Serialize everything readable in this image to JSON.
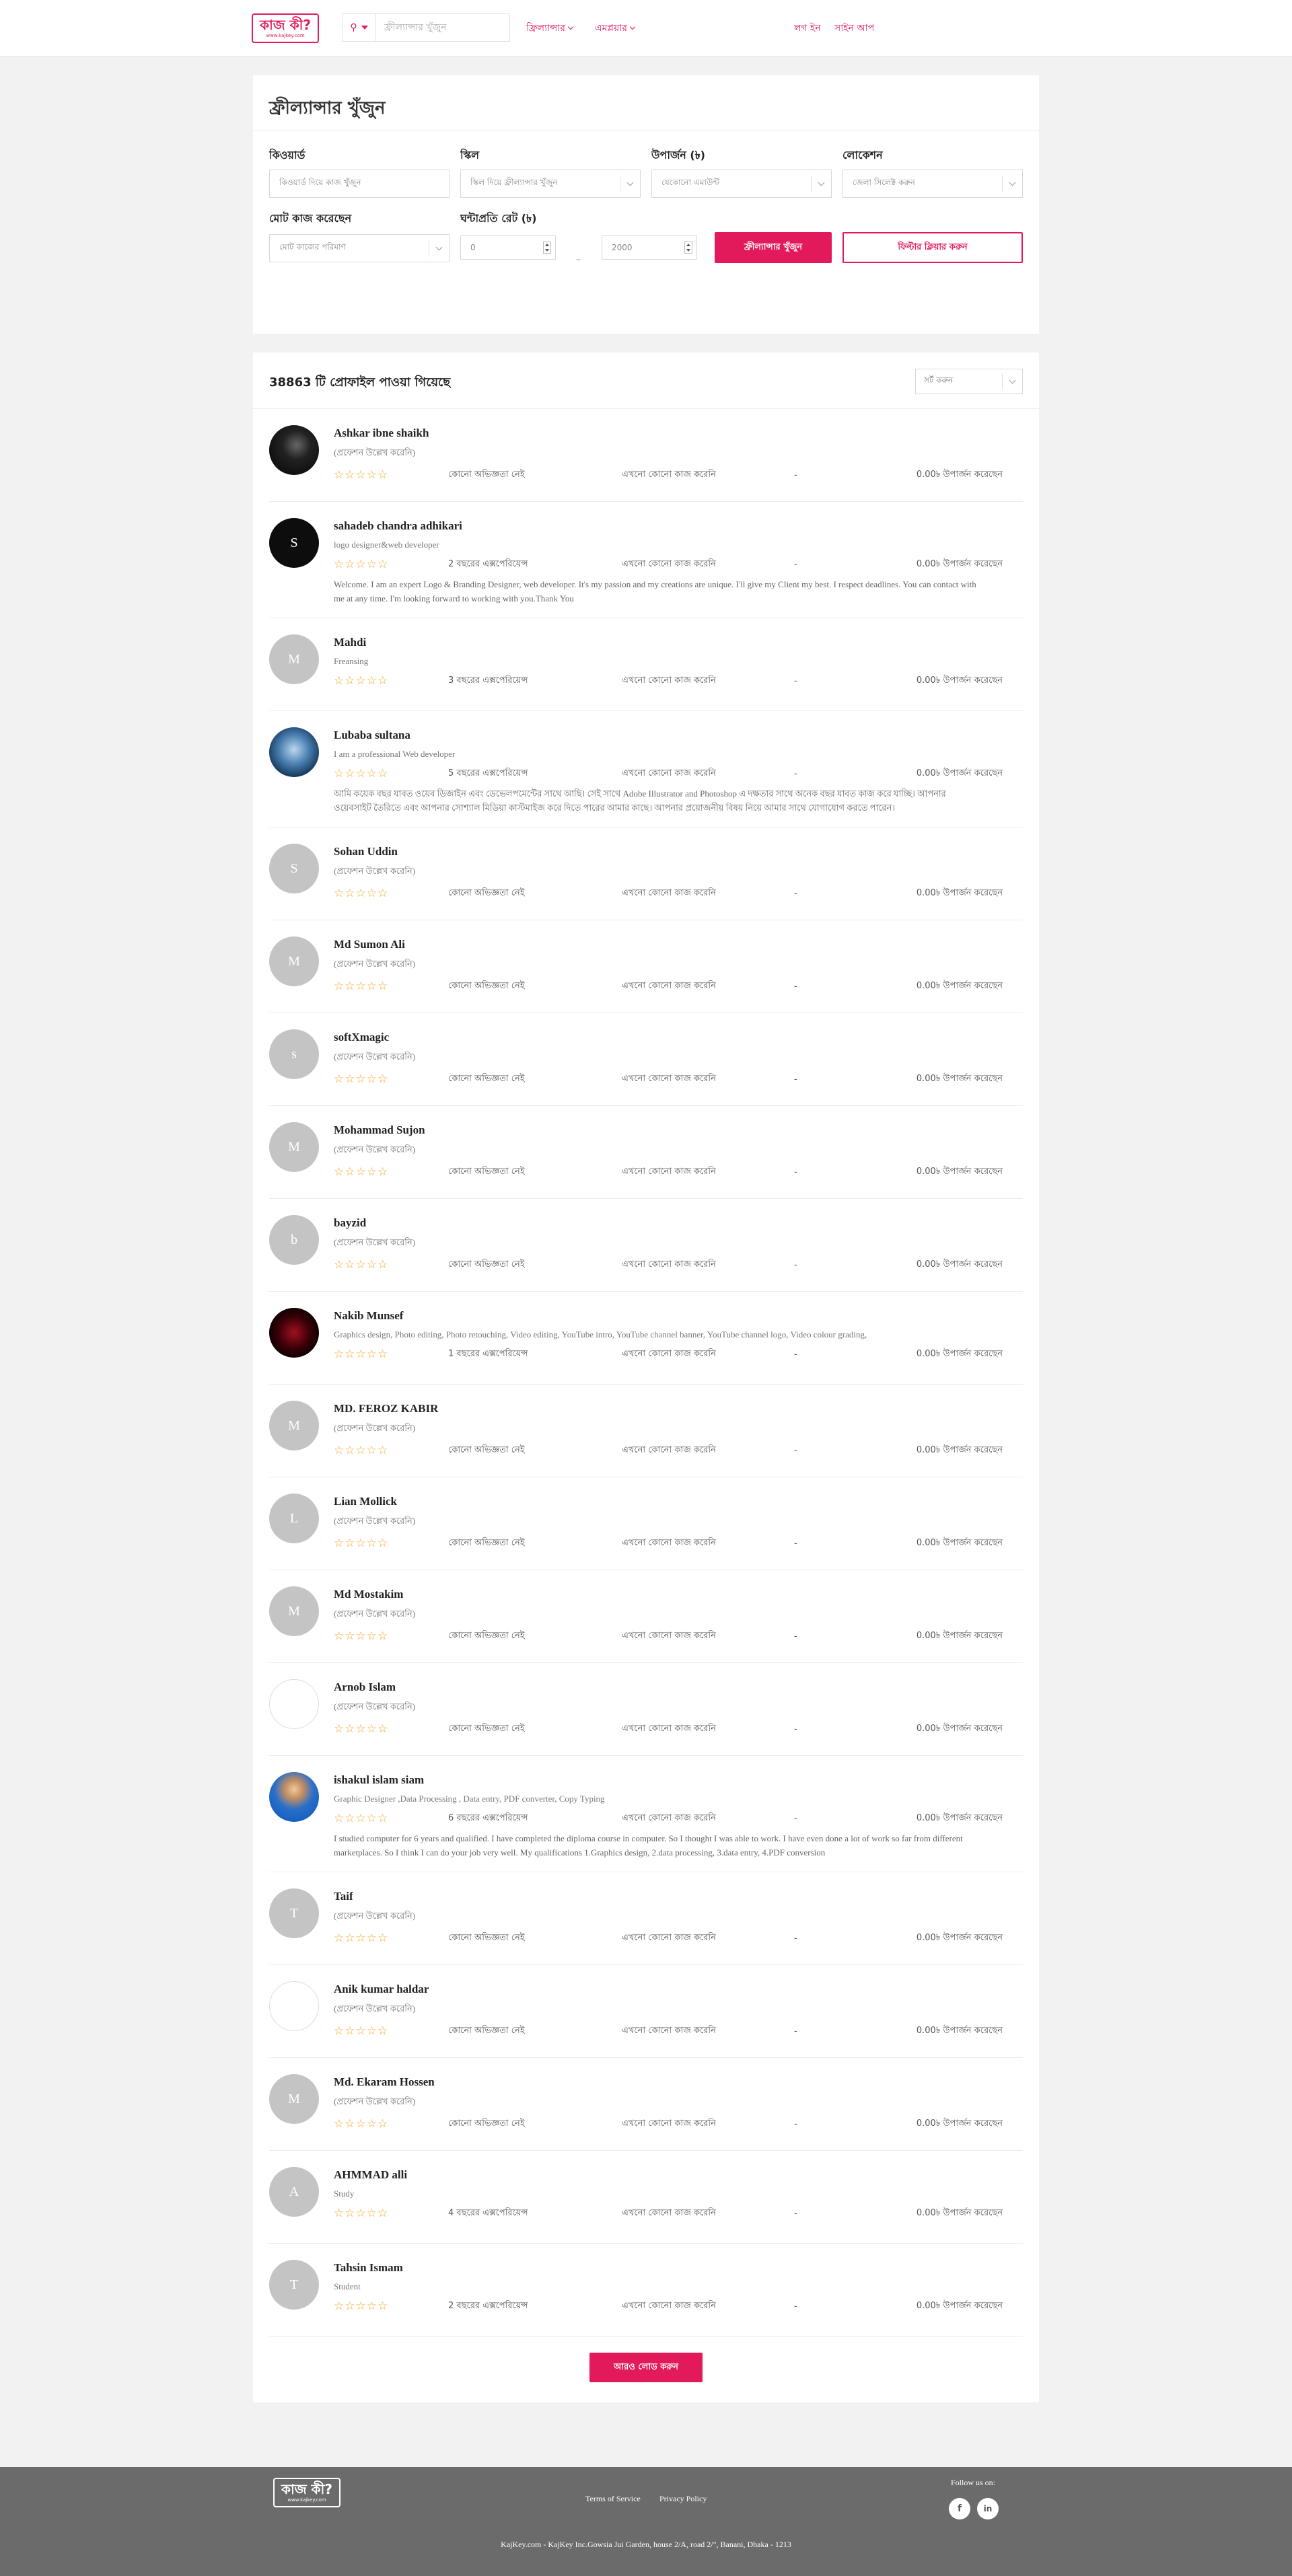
{
  "header": {
    "logo_text": "কাজ কী?",
    "logo_sub": "www.kajkey.com",
    "search_placeholder": "ফ্রীল্যান্সার খুঁজুন",
    "search_type_icon": "pin-icon",
    "nav_freelancer": "ফ্রিল্যান্সার",
    "nav_employer": "এমপ্লয়ার",
    "login": "লগ ইন",
    "signup": "সাইন আপ"
  },
  "filter": {
    "title": "ফ্রীল্যান্সার খুঁজুন",
    "keyword_label": "কিওয়ার্ড",
    "keyword_placeholder": "কিওয়ার্ড দিয়ে কাজ খুঁজুন",
    "skill_label": "স্কিল",
    "skill_placeholder": "স্কিল দিয়ে ফ্রীল্যান্সার খুঁজুন",
    "earning_label": "উপার্জন (৳)",
    "earning_placeholder": "যেকোনো এমাউন্ট",
    "location_label": "লোকেশন",
    "location_placeholder": "জেলা সিলেক্ট করুন",
    "jobs_done_label": "মোট কাজ করেছেন",
    "jobs_done_placeholder": "মোট কাজের পরিমাণ",
    "rate_label": "ঘন্টাপ্রতি রেট (৳)",
    "rate_min": "0",
    "rate_max": "2000",
    "rate_sep": "–",
    "search_button": "ফ্রীল্যান্সার খুঁজুন",
    "clear_button": "ফিল্টার ক্লিয়ার করুন"
  },
  "results": {
    "count_text": "38863 টি প্রোফাইল পাওয়া গিয়েছে",
    "sort_placeholder": "সর্ট করুন",
    "load_more": "আরও লোড করুন",
    "freelancers": [
      {
        "name": "Ashkar ibne shaikh",
        "tagline": "(প্রফেশন উল্লেখ করেনি)",
        "experience": "কোনো অভিজ্ঞতা নেই",
        "jobs": "এখনো কোনো কাজ করেনি",
        "dash": "-",
        "earning": "0.00৳ উপার্জন করেছেন",
        "avatar_initial": "",
        "avatar_style": "photo-dark",
        "bio": ""
      },
      {
        "name": "sahadeb chandra adhikari",
        "tagline": "logo designer&web developer",
        "experience": "2 বছরের এক্সপেরিয়েন্স",
        "jobs": "এখনো কোনো কাজ করেনি",
        "dash": "-",
        "earning": "0.00৳ উপার্জন করেছেন",
        "avatar_initial": "S",
        "avatar_style": "photo-logo",
        "bio": "Welcome. I am an expert Logo & Branding Designer, web developer. It's my passion and my creations are unique. I'll give my Client my best. I respect deadlines. You can contact with me at any time. I'm looking forward to working with you.Thank You"
      },
      {
        "name": "Mahdi",
        "tagline": "Freansing",
        "experience": "3 বছরের এক্সপেরিয়েন্স",
        "jobs": "এখনো কোনো কাজ করেনি",
        "dash": "-",
        "earning": "0.00৳ উপার্জন করেছেন",
        "avatar_initial": "M",
        "avatar_style": "",
        "bio": ""
      },
      {
        "name": "Lubaba sultana",
        "tagline": "I am a professional Web developer",
        "experience": "5 বছরের এক্সপেরিয়েন্স",
        "jobs": "এখনো কোনো কাজ করেনি",
        "dash": "-",
        "earning": "0.00৳ উপার্জন করেছেন",
        "avatar_initial": "",
        "avatar_style": "photo-blue",
        "bio": "আমি কয়েক বছর যাবত ওয়েব ডিজাইন এবং ডেভেলপমেন্টের সাথে আছি। সেই সাথে Adobe Illustrator and Photoshop এ দক্ষতার সাথে অনেক বছর যাবত কাজ করে যাচ্ছি। আপনার ওয়েবসাইট তৈরিতে এবং আপনার সোশ্যাল মিডিয়া কাস্টমাইজ করে দিতে পারের আমার কাছে। আপনার প্রয়োজনীয় বিষয় নিয়ে আমার সাথে যোগাযোগ করতে পারেন।"
      },
      {
        "name": "Sohan Uddin",
        "tagline": "(প্রফেশন উল্লেখ করেনি)",
        "experience": "কোনো অভিজ্ঞতা নেই",
        "jobs": "এখনো কোনো কাজ করেনি",
        "dash": "-",
        "earning": "0.00৳ উপার্জন করেছেন",
        "avatar_initial": "S",
        "avatar_style": "",
        "bio": ""
      },
      {
        "name": "Md Sumon Ali",
        "tagline": "(প্রফেশন উল্লেখ করেনি)",
        "experience": "কোনো অভিজ্ঞতা নেই",
        "jobs": "এখনো কোনো কাজ করেনি",
        "dash": "-",
        "earning": "0.00৳ উপার্জন করেছেন",
        "avatar_initial": "M",
        "avatar_style": "",
        "bio": ""
      },
      {
        "name": "softXmagic",
        "tagline": "(প্রফেশন উল্লেখ করেনি)",
        "experience": "কোনো অভিজ্ঞতা নেই",
        "jobs": "এখনো কোনো কাজ করেনি",
        "dash": "-",
        "earning": "0.00৳ উপার্জন করেছেন",
        "avatar_initial": "s",
        "avatar_style": "",
        "bio": ""
      },
      {
        "name": "Mohammad Sujon",
        "tagline": "(প্রফেশন উল্লেখ করেনি)",
        "experience": "কোনো অভিজ্ঞতা নেই",
        "jobs": "এখনো কোনো কাজ করেনি",
        "dash": "-",
        "earning": "0.00৳ উপার্জন করেছেন",
        "avatar_initial": "M",
        "avatar_style": "",
        "bio": ""
      },
      {
        "name": "bayzid",
        "tagline": "(প্রফেশন উল্লেখ করেনি)",
        "experience": "কোনো অভিজ্ঞতা নেই",
        "jobs": "এখনো কোনো কাজ করেনি",
        "dash": "-",
        "earning": "0.00৳ উপার্জন করেছেন",
        "avatar_initial": "b",
        "avatar_style": "",
        "bio": ""
      },
      {
        "name": "Nakib Munsef",
        "tagline": "Graphics design, Photo editing, Photo retouching, Video editing, YouTube intro, YouTube channel banner, YouTube channel logo, Video colour grading,",
        "experience": "1 বছরের এক্সপেরিয়েন্স",
        "jobs": "এখনো কোনো কাজ করেনি",
        "dash": "-",
        "earning": "0.00৳ উপার্জন করেছেন",
        "avatar_initial": "",
        "avatar_style": "photo-red",
        "bio": ""
      },
      {
        "name": "MD. FEROZ KABIR",
        "tagline": "(প্রফেশন উল্লেখ করেনি)",
        "experience": "কোনো অভিজ্ঞতা নেই",
        "jobs": "এখনো কোনো কাজ করেনি",
        "dash": "-",
        "earning": "0.00৳ উপার্জন করেছেন",
        "avatar_initial": "M",
        "avatar_style": "",
        "bio": ""
      },
      {
        "name": "Lian Mollick",
        "tagline": "(প্রফেশন উল্লেখ করেনি)",
        "experience": "কোনো অভিজ্ঞতা নেই",
        "jobs": "এখনো কোনো কাজ করেনি",
        "dash": "-",
        "earning": "0.00৳ উপার্জন করেছেন",
        "avatar_initial": "L",
        "avatar_style": "",
        "bio": ""
      },
      {
        "name": "Md Mostakim",
        "tagline": "(প্রফেশন উল্লেখ করেনি)",
        "experience": "কোনো অভিজ্ঞতা নেই",
        "jobs": "এখনো কোনো কাজ করেনি",
        "dash": "-",
        "earning": "0.00৳ উপার্জন করেছেন",
        "avatar_initial": "M",
        "avatar_style": "",
        "bio": ""
      },
      {
        "name": "Arnob Islam",
        "tagline": "(প্রফেশন উল্লেখ করেনি)",
        "experience": "কোনো অভিজ্ঞতা নেই",
        "jobs": "এখনো কোনো কাজ করেনি",
        "dash": "-",
        "earning": "0.00৳ উপার্জন করেছেন",
        "avatar_initial": "",
        "avatar_style": "photo-blank",
        "bio": ""
      },
      {
        "name": "ishakul islam siam",
        "tagline": "Graphic Designer ,Data Processing , Data entry, PDF converter, Copy Typing",
        "experience": "6 বছরের এক্সপেরিয়েন্স",
        "jobs": "এখনো কোনো কাজ করেনি",
        "dash": "-",
        "earning": "0.00৳ উপার্জন করেছেন",
        "avatar_initial": "",
        "avatar_style": "photo-man",
        "bio": "I studied computer for 6 years and qualified. I have completed the diploma course in computer. So I thought I was able to work. I have even done a lot of work so far from different marketplaces. So I think I can do your job very well. My qualifications                1.Graphics design,                2.data processing,                3.data entry,                4.PDF conversion"
      },
      {
        "name": "Taif",
        "tagline": "(প্রফেশন উল্লেখ করেনি)",
        "experience": "কোনো অভিজ্ঞতা নেই",
        "jobs": "এখনো কোনো কাজ করেনি",
        "dash": "-",
        "earning": "0.00৳ উপার্জন করেছেন",
        "avatar_initial": "T",
        "avatar_style": "",
        "bio": ""
      },
      {
        "name": "Anik kumar haldar",
        "tagline": "(প্রফেশন উল্লেখ করেনি)",
        "experience": "কোনো অভিজ্ঞতা নেই",
        "jobs": "এখনো কোনো কাজ করেনি",
        "dash": "-",
        "earning": "0.00৳ উপার্জন করেছেন",
        "avatar_initial": "",
        "avatar_style": "photo-blank",
        "bio": ""
      },
      {
        "name": "Md. Ekaram Hossen",
        "tagline": "(প্রফেশন উল্লেখ করেনি)",
        "experience": "কোনো অভিজ্ঞতা নেই",
        "jobs": "এখনো কোনো কাজ করেনি",
        "dash": "-",
        "earning": "0.00৳ উপার্জন করেছেন",
        "avatar_initial": "M",
        "avatar_style": "",
        "bio": ""
      },
      {
        "name": "AHMMAD alli",
        "tagline": "Study",
        "experience": "4 বছরের এক্সপেরিয়েন্স",
        "jobs": "এখনো কোনো কাজ করেনি",
        "dash": "-",
        "earning": "0.00৳ উপার্জন করেছেন",
        "avatar_initial": "A",
        "avatar_style": "",
        "bio": ""
      },
      {
        "name": "Tahsin Ismam",
        "tagline": "Student",
        "experience": "2 বছরের এক্সপেরিয়েন্স",
        "jobs": "এখনো কোনো কাজ করেনি",
        "dash": "-",
        "earning": "0.00৳ উপার্জন করেছেন",
        "avatar_initial": "T",
        "avatar_style": "",
        "bio": ""
      }
    ]
  },
  "footer": {
    "logo_text": "কাজ কী?",
    "logo_sub": "www.kajkey.com",
    "terms": "Terms of Service",
    "privacy": "Privacy Policy",
    "follow": "Follow us on:",
    "facebook_glyph": "f",
    "linkedin_glyph": "in",
    "address": "KajKey.com - KajKey Inc.Gowsia Jui Garden, house 2/A, road 2/\", Banani, Dhaka - 1213"
  },
  "colors": {
    "accent": "#e2195b",
    "star": "#f5a623",
    "footer_bg": "#6b6b6b"
  }
}
